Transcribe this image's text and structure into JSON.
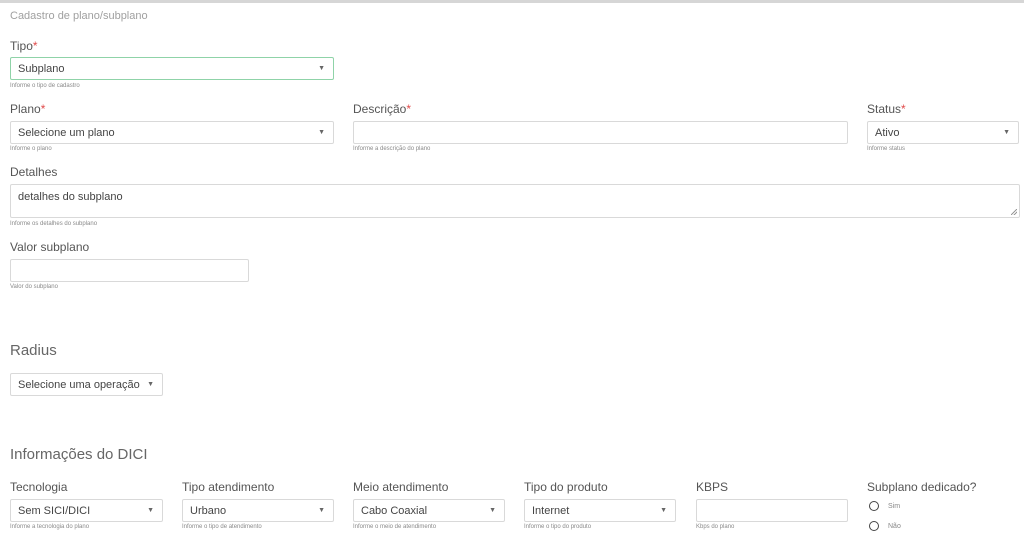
{
  "page": {
    "title": "Cadastro de plano/subplano"
  },
  "tipo": {
    "label": "Tipo",
    "required": "*",
    "value": "Subplano",
    "help": "Informe o tipo de cadastro"
  },
  "plano": {
    "label": "Plano",
    "required": "*",
    "value": "Selecione um plano",
    "help": "Informe o plano"
  },
  "descricao": {
    "label": "Descrição",
    "required": "*",
    "value": "",
    "help": "Informe a descrição do plano"
  },
  "status": {
    "label": "Status",
    "required": "*",
    "value": "Ativo",
    "help": "Informe status"
  },
  "detalhes": {
    "label": "Detalhes",
    "value": "detalhes do subplano",
    "help": "Informe os detalhes do subplano"
  },
  "valor": {
    "label": "Valor subplano",
    "value": "",
    "help": "Valor do subplano"
  },
  "radius": {
    "title": "Radius",
    "select_value": "Selecione uma operação"
  },
  "dici": {
    "title": "Informações do DICI",
    "tecnologia": {
      "label": "Tecnologia",
      "value": "Sem SICI/DICI",
      "help": "Informe a tecnologia do plano"
    },
    "tipo_atendimento": {
      "label": "Tipo atendimento",
      "value": "Urbano",
      "help": "Informe o tipo de atendimento"
    },
    "meio_atendimento": {
      "label": "Meio atendimento",
      "value": "Cabo Coaxial",
      "help": "Informe o meio de atendimento"
    },
    "tipo_produto": {
      "label": "Tipo do produto",
      "value": "Internet",
      "help": "Informe o tipo do produto"
    },
    "kbps": {
      "label": "KBPS",
      "value": "",
      "help": "Kbps do plano"
    },
    "dedicado": {
      "label": "Subplano dedicado?",
      "options": [
        "Sim",
        "Não"
      ]
    }
  },
  "icons": {
    "caret": "caret-down-icon",
    "resize": "resize-grip-icon"
  }
}
